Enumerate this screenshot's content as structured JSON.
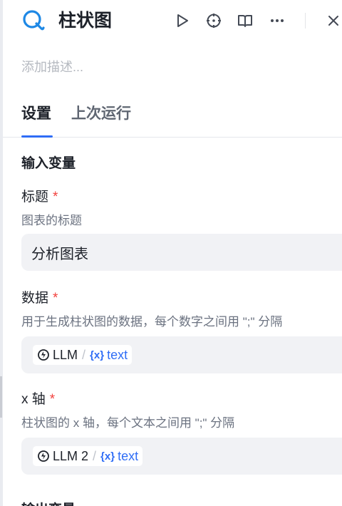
{
  "header": {
    "title": "柱状图",
    "description_placeholder": "添加描述..."
  },
  "tabs": [
    {
      "label": "设置"
    },
    {
      "label": "上次运行"
    }
  ],
  "input_section": {
    "title": "输入变量"
  },
  "fields": [
    {
      "label": "标题",
      "required_mark": "*",
      "hint": "图表的标题",
      "value": "分析图表"
    },
    {
      "label": "数据",
      "required_mark": "*",
      "hint": "用于生成柱状图的数据，每个数字之间用 \";\" 分隔",
      "node": "LLM",
      "separator": "/",
      "var_icon": "{x}",
      "variable": "text"
    },
    {
      "label": "x 轴",
      "required_mark": "*",
      "hint": "柱状图的 x 轴，每个文本之间用 \";\" 分隔",
      "node": "LLM 2",
      "separator": "/",
      "var_icon": "{x}",
      "variable": "text"
    }
  ],
  "output_section": {
    "title": "输出变量"
  },
  "icons": {
    "app": "chart-app-icon",
    "run": "play-icon",
    "target": "target-icon",
    "docs": "book-icon",
    "more": "more-icon",
    "close": "close-icon"
  },
  "colors": {
    "accent": "#2f6df6",
    "required": "#f2403d"
  }
}
